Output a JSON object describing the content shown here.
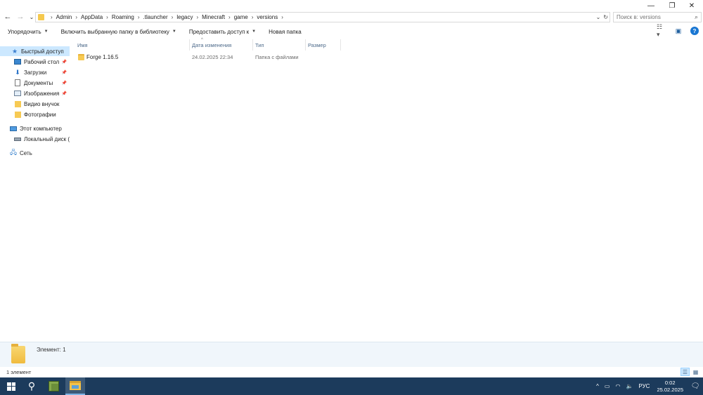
{
  "window": {
    "minimize_symbol": "—",
    "maximize_symbol": "❐",
    "close_symbol": "✕"
  },
  "address_bar": {
    "crumbs": [
      "Admin",
      "AppData",
      "Roaming",
      ".tlauncher",
      "legacy",
      "Minecraft",
      "game",
      "versions"
    ],
    "separator": "›"
  },
  "search": {
    "placeholder": "Поиск в: versions"
  },
  "toolbar": {
    "organize": "Упорядочить",
    "include_library": "Включить выбранную папку в библиотеку",
    "share": "Предоставить доступ к",
    "new_folder": "Новая папка"
  },
  "nav_pane": {
    "quick_access": "Быстрый доступ",
    "desktop": "Рабочий стол",
    "downloads": "Загрузки",
    "documents": "Документы",
    "pictures": "Изображения",
    "video": "Видио внучок",
    "photos": "Фотографии",
    "this_pc": "Этот компьютер",
    "local_disk": "Локальный диск (С",
    "network": "Сеть"
  },
  "columns": {
    "name": "Имя",
    "date": "Дата изменения",
    "type": "Тип",
    "size": "Размер"
  },
  "files": [
    {
      "name": "Forge 1.16.5",
      "date": "24.02.2025 22:34",
      "type": "Папка с файлами",
      "size": ""
    }
  ],
  "details": {
    "label": "Элемент: 1"
  },
  "status": {
    "count": "1 элемент"
  },
  "taskbar": {
    "language": "РУС",
    "time": "0:02",
    "date": "25.02.2025"
  },
  "colors": {
    "accent": "#1976d2",
    "taskbar": "#1c3b5c",
    "selection": "#cce8ff",
    "folder": "#f7ca54"
  }
}
